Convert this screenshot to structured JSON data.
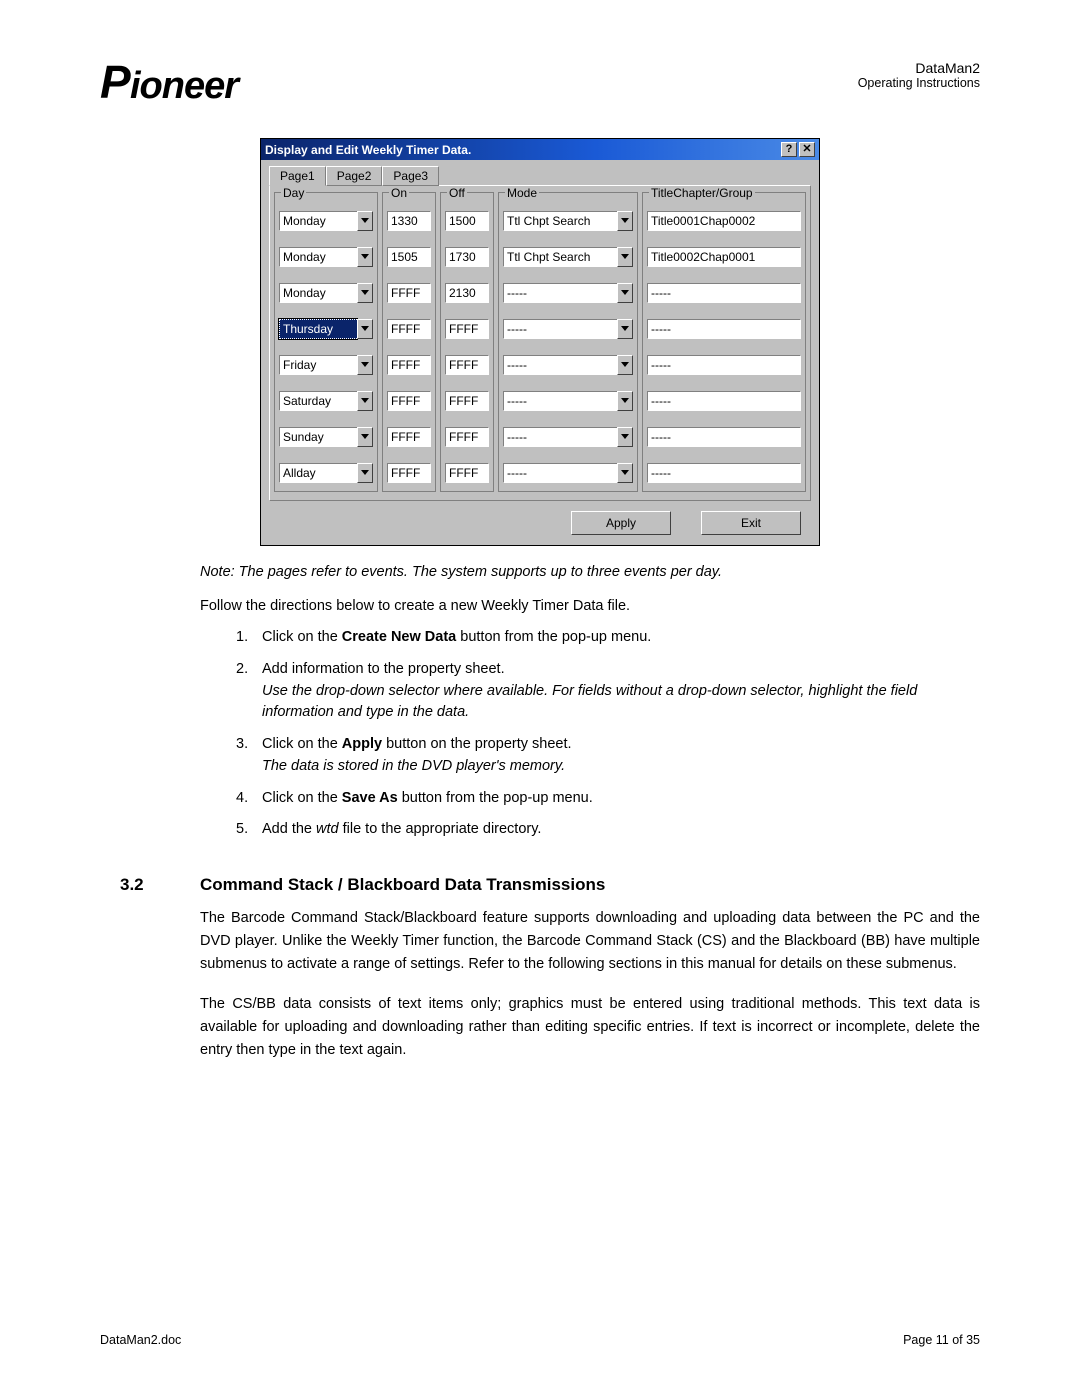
{
  "header": {
    "logo_text": "Pioneer",
    "product": "DataMan2",
    "subtitle": "Operating Instructions"
  },
  "dialog": {
    "title": "Display and Edit Weekly Timer Data.",
    "help_glyph": "?",
    "close_glyph": "✕",
    "tabs": [
      "Page1",
      "Page2",
      "Page3"
    ],
    "active_tab": 0,
    "columns": {
      "day": "Day",
      "on": "On",
      "off": "Off",
      "mode": "Mode",
      "tcg": "TitleChapter/Group"
    },
    "rows": [
      {
        "day": "Monday",
        "on": "1330",
        "off": "1500",
        "mode": "Ttl Chpt Search",
        "tcg": "Title0001Chap0002",
        "selected": false
      },
      {
        "day": "Monday",
        "on": "1505",
        "off": "1730",
        "mode": "Ttl Chpt Search",
        "tcg": "Title0002Chap0001",
        "selected": false
      },
      {
        "day": "Monday",
        "on": "FFFF",
        "off": "2130",
        "mode": "-----",
        "tcg": "-----",
        "selected": false
      },
      {
        "day": "Thursday",
        "on": "FFFF",
        "off": "FFFF",
        "mode": "-----",
        "tcg": "-----",
        "selected": true
      },
      {
        "day": "Friday",
        "on": "FFFF",
        "off": "FFFF",
        "mode": "-----",
        "tcg": "-----",
        "selected": false
      },
      {
        "day": "Saturday",
        "on": "FFFF",
        "off": "FFFF",
        "mode": "-----",
        "tcg": "-----",
        "selected": false
      },
      {
        "day": "Sunday",
        "on": "FFFF",
        "off": "FFFF",
        "mode": "-----",
        "tcg": "-----",
        "selected": false
      },
      {
        "day": "Allday",
        "on": "FFFF",
        "off": "FFFF",
        "mode": "-----",
        "tcg": "-----",
        "selected": false
      }
    ],
    "buttons": {
      "apply": "Apply",
      "exit": "Exit"
    }
  },
  "body": {
    "note": "Note: The pages refer to events.  The system supports up to three events per day.",
    "intro": "Follow the directions below to create a new Weekly Timer Data file.",
    "steps": [
      {
        "n": "1.",
        "pre": "Click on the ",
        "bold": "Create New Data",
        "post": " button from the pop-up menu."
      },
      {
        "n": "2.",
        "pre": "Add information to the property sheet.",
        "bold": "",
        "post": "",
        "sub": "Use the drop-down selector where available.  For fields without a drop-down selector, highlight the field information and type in the data."
      },
      {
        "n": "3.",
        "pre": "Click on the ",
        "bold": "Apply",
        "post": " button on the property sheet.",
        "sub": "The data is stored in the DVD player's memory."
      },
      {
        "n": "4.",
        "pre": "Click on the ",
        "bold": "Save As",
        "post": " button from the pop-up menu."
      },
      {
        "n": "5.",
        "pre": "Add the ",
        "ital": "wtd",
        "post2": " file to the appropriate directory."
      }
    ],
    "section_num": "3.2",
    "section_title": "Command Stack / Blackboard Data Transmissions",
    "p1": "The Barcode Command Stack/Blackboard feature supports downloading and uploading data between the PC and the DVD player.  Unlike the Weekly Timer function, the Barcode Command Stack (CS) and the Blackboard (BB) have multiple submenus to activate a range of settings. Refer to the following sections in this manual for details on these submenus.",
    "p2": "The CS/BB data consists of text items only; graphics must be entered using traditional methods. This text data is available for uploading and downloading rather than editing specific entries.  If text is incorrect or incomplete, delete the entry then type in the text again."
  },
  "footer": {
    "left": "DataMan2.doc",
    "right": "Page 11 of 35"
  }
}
